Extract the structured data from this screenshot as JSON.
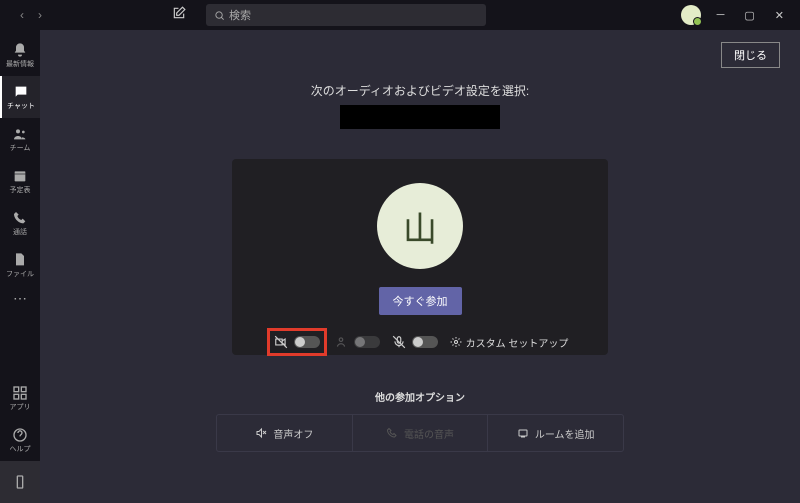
{
  "search": {
    "placeholder": "検索"
  },
  "rail": {
    "activity": "最新情報",
    "chat": "チャット",
    "teams": "チーム",
    "calendar": "予定表",
    "calls": "通話",
    "files": "ファイル",
    "apps": "アプリ",
    "help": "ヘルプ"
  },
  "close_button": "閉じる",
  "heading": "次のオーディオおよびビデオ設定を選択:",
  "avatar_initial": "山",
  "join_now": "今すぐ参加",
  "custom_setup": "カスタム セットアップ",
  "other_options_title": "他の参加オプション",
  "options": {
    "audio_off": "音声オフ",
    "phone_audio": "電話の音声",
    "add_room": "ルームを追加"
  }
}
